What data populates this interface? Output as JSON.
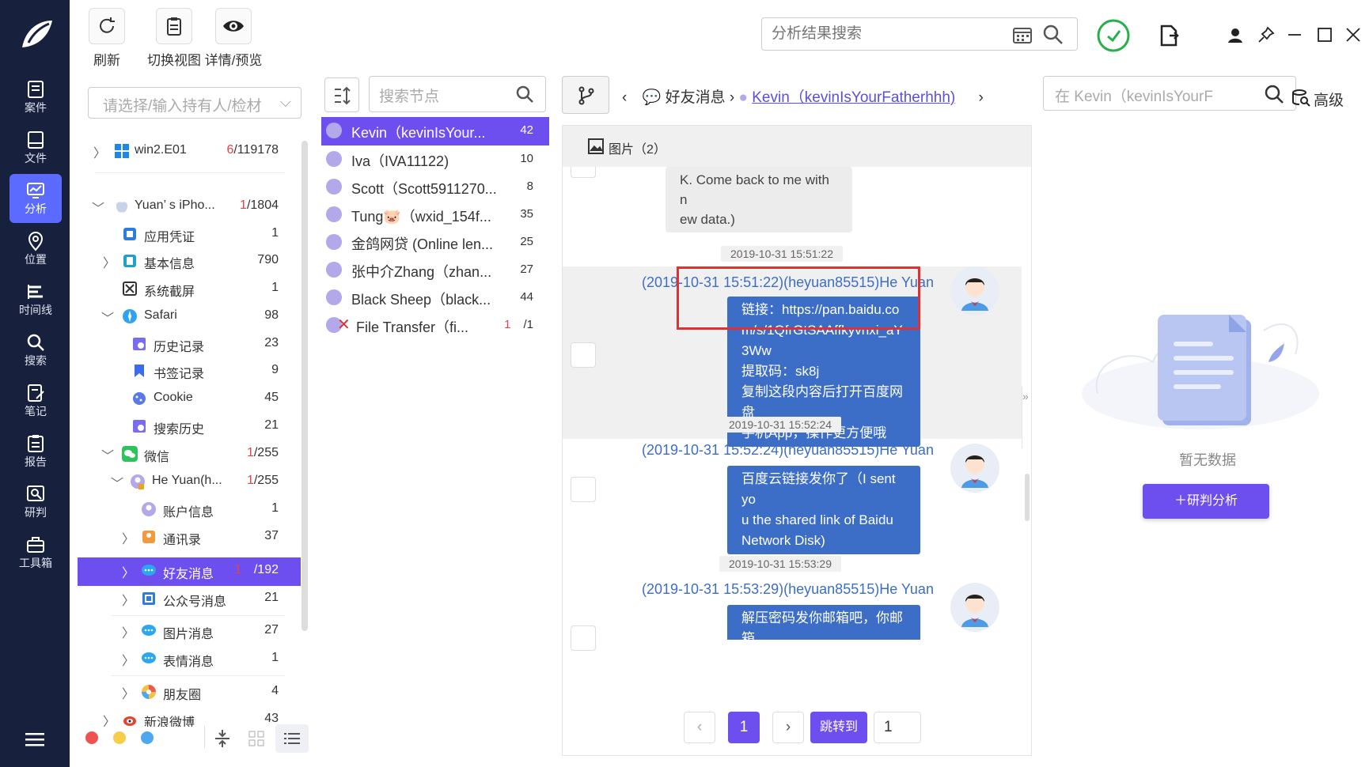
{
  "toolbar": {
    "refresh_label": "刷新",
    "switch_view_label": "切换视图",
    "details_label": "详情/预览",
    "search_placeholder": "分析结果搜索"
  },
  "nav": {
    "items": [
      {
        "label": "案件",
        "icon": "case-icon"
      },
      {
        "label": "文件",
        "icon": "file-icon"
      },
      {
        "label": "分析",
        "icon": "analysis-icon"
      },
      {
        "label": "位置",
        "icon": "location-icon"
      },
      {
        "label": "时间线",
        "icon": "timeline-icon"
      },
      {
        "label": "搜索",
        "icon": "search-icon"
      },
      {
        "label": "笔记",
        "icon": "note-icon"
      },
      {
        "label": "报告",
        "icon": "report-icon"
      },
      {
        "label": "研判",
        "icon": "judge-icon"
      },
      {
        "label": "工具箱",
        "icon": "toolbox-icon"
      }
    ],
    "active_index": 2
  },
  "tree": {
    "select_placeholder": "请选择/输入持有人/检材",
    "rows": [
      {
        "label": "win2.E01",
        "count_red": "6",
        "count": "/119178"
      },
      {
        "label": "Yuan’ s iPho...",
        "count_red": "1",
        "count": "/1804"
      },
      {
        "label": "应用凭证",
        "count_red": "",
        "count": "1"
      },
      {
        "label": "基本信息",
        "count_red": "",
        "count": "790"
      },
      {
        "label": "系统截屏",
        "count_red": "",
        "count": "1"
      },
      {
        "label": "Safari",
        "count_red": "",
        "count": "98"
      },
      {
        "label": "历史记录",
        "count_red": "",
        "count": "23"
      },
      {
        "label": "书签记录",
        "count_red": "",
        "count": "9"
      },
      {
        "label": "Cookie",
        "count_red": "",
        "count": "45"
      },
      {
        "label": "搜索历史",
        "count_red": "",
        "count": "21"
      },
      {
        "label": "微信",
        "count_red": "1",
        "count": "/255"
      },
      {
        "label": "He Yuan(h...",
        "count_red": "1",
        "count": "/255"
      },
      {
        "label": "账户信息",
        "count_red": "",
        "count": "1"
      },
      {
        "label": "通讯录",
        "count_red": "",
        "count": "37"
      },
      {
        "label": "好友消息",
        "count_red": "1",
        "count": "/192"
      },
      {
        "label": "公众号消息",
        "count_red": "",
        "count": "21"
      },
      {
        "label": "图片消息",
        "count_red": "",
        "count": "27"
      },
      {
        "label": "表情消息",
        "count_red": "",
        "count": "1"
      },
      {
        "label": "朋友圈",
        "count_red": "",
        "count": "4"
      },
      {
        "label": "新浪微博",
        "count_red": "",
        "count": "43"
      }
    ]
  },
  "contacts": {
    "search_placeholder": "搜索节点",
    "rows": [
      {
        "name": "Kevin（kevinIsYour...",
        "count": "42"
      },
      {
        "name": "Iva（IVA11122)",
        "count": "10"
      },
      {
        "name": "Scott（Scott5911270...",
        "count": "8"
      },
      {
        "name": "Tung🐷（wxid_154f...",
        "count": "35"
      },
      {
        "name": "金鸽网贷 (Online len...",
        "count": "25"
      },
      {
        "name": "张中介Zhang（zhan...",
        "count": "27"
      },
      {
        "name": "Black Sheep（black...",
        "count": "44"
      },
      {
        "name": "File Transfer（fi...",
        "count_red": "1",
        "count": "/1"
      }
    ]
  },
  "chat": {
    "crumb_section": "好友消息",
    "crumb_contact": "Kevin（kevinIsYourFatherhhh)",
    "search_placeholder": "在 Kevin（kevinIsYourF",
    "advanced_label": "高级",
    "images_header": "图片（2）",
    "prev_bubble": "K. Come back to me with n\new data.)",
    "messages": [
      {
        "timestamp": "2019-10-31 15:51:22",
        "meta": "(2019-10-31 15:51:22)(heyuan85515)He Yuan",
        "text": "链接：https://pan.baidu.co\nm/s/1QfrGtSAAffkyvnxi_aY\n3Ww\n提取码：sk8j\n复制这段内容后打开百度网盘\n手机App，操作更方便哦"
      },
      {
        "timestamp": "2019-10-31 15:52:24",
        "meta": "(2019-10-31 15:52:24)(heyuan85515)He Yuan",
        "text": "百度云链接发你了（I sent yo\nu the shared link of Baidu\nNetwork Disk)"
      },
      {
        "timestamp": "2019-10-31 15:53:29",
        "meta": "(2019-10-31 15:53:29)(heyuan85515)He Yuan",
        "text": "解压密码发你邮箱吧，你邮箱\n给我（What's your email ad"
      }
    ]
  },
  "pager": {
    "current": "1",
    "jump_label": "跳转到",
    "jump_value": "1"
  },
  "analysis": {
    "empty_label": "暂无数据",
    "analyze_button": "研判分析"
  },
  "colors": {
    "nav_bg": "#17203d",
    "accent": "#6d4ff0",
    "bubble": "#3c6ec8",
    "highlight": "#e03030"
  }
}
